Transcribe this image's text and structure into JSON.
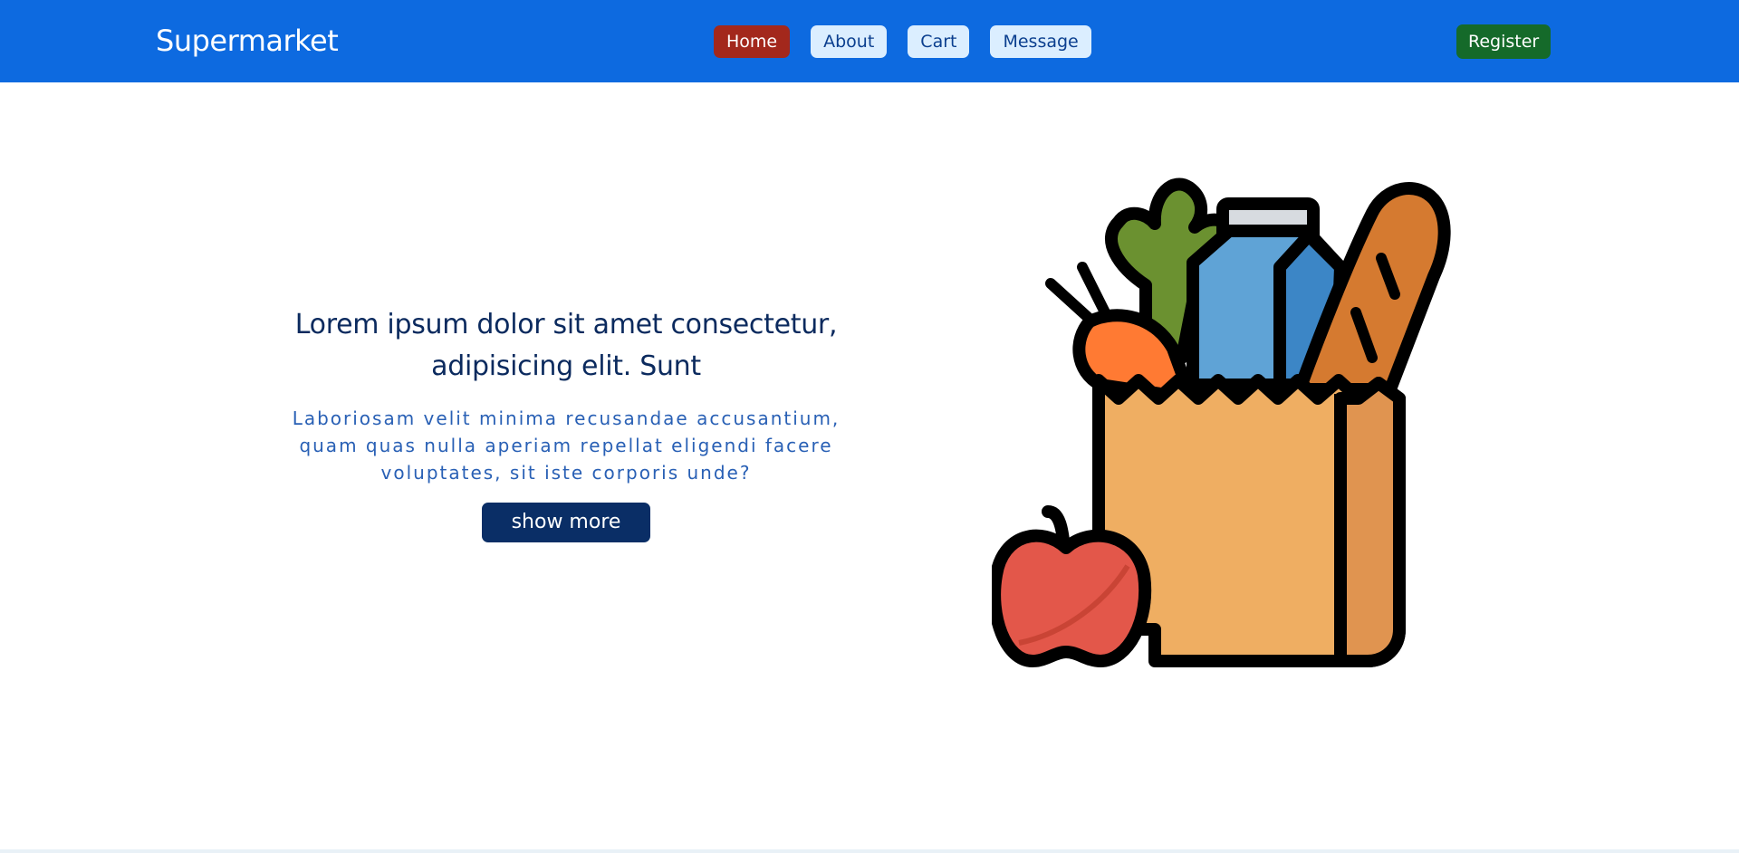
{
  "navbar": {
    "brand": "Supermarket",
    "links": [
      {
        "label": "Home",
        "active": true
      },
      {
        "label": "About",
        "active": false
      },
      {
        "label": "Cart",
        "active": false
      },
      {
        "label": "Message",
        "active": false
      }
    ],
    "register_label": "Register"
  },
  "hero": {
    "headline": "Lorem ipsum dolor sit amet consectetur, adipisicing elit. Sunt",
    "subtext": "Laboriosam velit minima recusandae accusantium, quam quas nulla aperiam repellat eligendi facere voluptates, sit iste corporis unde?",
    "button_label": "show more",
    "illustration_icon": "grocery-bag-icon"
  },
  "colors": {
    "navbar": "#0d6ae0",
    "active_nav": "#a3281c",
    "inactive_nav": "#dbeeff",
    "register": "#156a2a",
    "headline": "#0b2a5e",
    "subtext": "#2960b5",
    "show_more": "#0a2e66"
  }
}
